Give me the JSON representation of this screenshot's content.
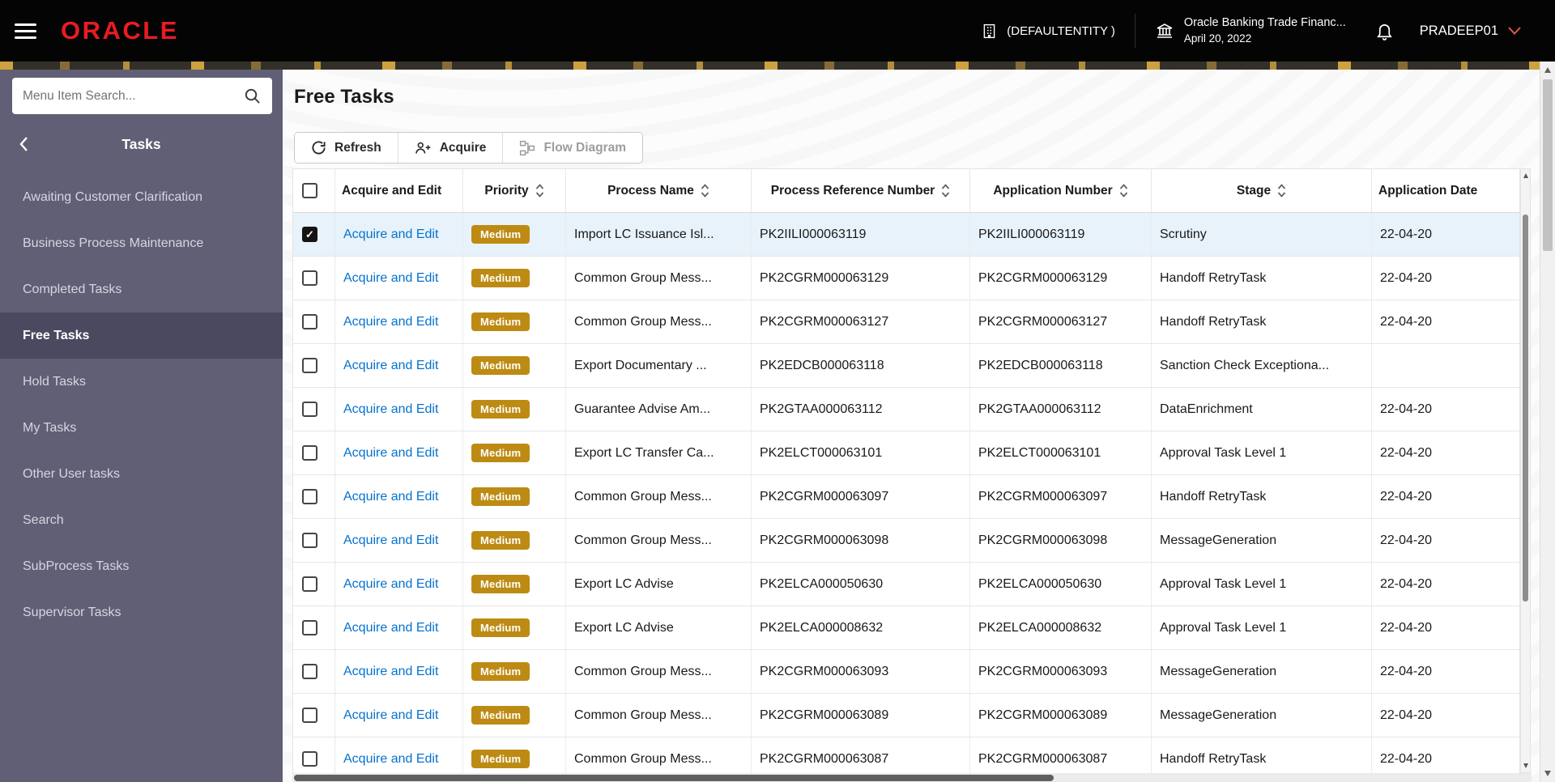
{
  "header": {
    "brand": "ORACLE",
    "entity_label": "(DEFAULTENTITY )",
    "org_name": "Oracle Banking Trade Financ...",
    "org_date": "April 20, 2022",
    "username": "PRADEEP01"
  },
  "sidebar": {
    "search_placeholder": "Menu Item Search...",
    "title": "Tasks",
    "items": [
      {
        "label": "Awaiting Customer Clarification",
        "active": false
      },
      {
        "label": "Business Process Maintenance",
        "active": false
      },
      {
        "label": "Completed Tasks",
        "active": false
      },
      {
        "label": "Free Tasks",
        "active": true
      },
      {
        "label": "Hold Tasks",
        "active": false
      },
      {
        "label": "My Tasks",
        "active": false
      },
      {
        "label": "Other User tasks",
        "active": false
      },
      {
        "label": "Search",
        "active": false
      },
      {
        "label": "SubProcess Tasks",
        "active": false
      },
      {
        "label": "Supervisor Tasks",
        "active": false
      }
    ]
  },
  "main": {
    "title": "Free Tasks",
    "toolbar": {
      "refresh_label": "Refresh",
      "acquire_label": "Acquire",
      "flow_diagram_label": "Flow Diagram",
      "flow_diagram_disabled": true
    },
    "table": {
      "columns": [
        {
          "label": "Acquire and Edit",
          "sortable": false
        },
        {
          "label": "Priority",
          "sortable": true
        },
        {
          "label": "Process Name",
          "sortable": true
        },
        {
          "label": "Process Reference Number",
          "sortable": true
        },
        {
          "label": "Application Number",
          "sortable": true
        },
        {
          "label": "Stage",
          "sortable": true
        },
        {
          "label": "Application Date",
          "sortable": false
        }
      ],
      "rows": [
        {
          "selected": true,
          "checked": true,
          "action": "Acquire and Edit",
          "priority": "Medium",
          "process_name": "Import LC Issuance Isl...",
          "process_ref": "PK2IILI000063119",
          "app_no": "PK2IILI000063119",
          "stage": "Scrutiny",
          "app_date": "22-04-20"
        },
        {
          "selected": false,
          "checked": false,
          "action": "Acquire and Edit",
          "priority": "Medium",
          "process_name": "Common Group Mess...",
          "process_ref": "PK2CGRM000063129",
          "app_no": "PK2CGRM000063129",
          "stage": "Handoff RetryTask",
          "app_date": "22-04-20"
        },
        {
          "selected": false,
          "checked": false,
          "action": "Acquire and Edit",
          "priority": "Medium",
          "process_name": "Common Group Mess...",
          "process_ref": "PK2CGRM000063127",
          "app_no": "PK2CGRM000063127",
          "stage": "Handoff RetryTask",
          "app_date": "22-04-20"
        },
        {
          "selected": false,
          "checked": false,
          "action": "Acquire and Edit",
          "priority": "Medium",
          "process_name": "Export Documentary ...",
          "process_ref": "PK2EDCB000063118",
          "app_no": "PK2EDCB000063118",
          "stage": "Sanction Check Exceptiona...",
          "app_date": ""
        },
        {
          "selected": false,
          "checked": false,
          "action": "Acquire and Edit",
          "priority": "Medium",
          "process_name": "Guarantee Advise Am...",
          "process_ref": "PK2GTAA000063112",
          "app_no": "PK2GTAA000063112",
          "stage": "DataEnrichment",
          "app_date": "22-04-20"
        },
        {
          "selected": false,
          "checked": false,
          "action": "Acquire and Edit",
          "priority": "Medium",
          "process_name": "Export LC Transfer Ca...",
          "process_ref": "PK2ELCT000063101",
          "app_no": "PK2ELCT000063101",
          "stage": "Approval Task Level 1",
          "app_date": "22-04-20"
        },
        {
          "selected": false,
          "checked": false,
          "action": "Acquire and Edit",
          "priority": "Medium",
          "process_name": "Common Group Mess...",
          "process_ref": "PK2CGRM000063097",
          "app_no": "PK2CGRM000063097",
          "stage": "Handoff RetryTask",
          "app_date": "22-04-20"
        },
        {
          "selected": false,
          "checked": false,
          "action": "Acquire and Edit",
          "priority": "Medium",
          "process_name": "Common Group Mess...",
          "process_ref": "PK2CGRM000063098",
          "app_no": "PK2CGRM000063098",
          "stage": "MessageGeneration",
          "app_date": "22-04-20"
        },
        {
          "selected": false,
          "checked": false,
          "action": "Acquire and Edit",
          "priority": "Medium",
          "process_name": "Export LC Advise",
          "process_ref": "PK2ELCA000050630",
          "app_no": "PK2ELCA000050630",
          "stage": "Approval Task Level 1",
          "app_date": "22-04-20"
        },
        {
          "selected": false,
          "checked": false,
          "action": "Acquire and Edit",
          "priority": "Medium",
          "process_name": "Export LC Advise",
          "process_ref": "PK2ELCA000008632",
          "app_no": "PK2ELCA000008632",
          "stage": "Approval Task Level 1",
          "app_date": "22-04-20"
        },
        {
          "selected": false,
          "checked": false,
          "action": "Acquire and Edit",
          "priority": "Medium",
          "process_name": "Common Group Mess...",
          "process_ref": "PK2CGRM000063093",
          "app_no": "PK2CGRM000063093",
          "stage": "MessageGeneration",
          "app_date": "22-04-20"
        },
        {
          "selected": false,
          "checked": false,
          "action": "Acquire and Edit",
          "priority": "Medium",
          "process_name": "Common Group Mess...",
          "process_ref": "PK2CGRM000063089",
          "app_no": "PK2CGRM000063089",
          "stage": "MessageGeneration",
          "app_date": "22-04-20"
        },
        {
          "selected": false,
          "checked": false,
          "action": "Acquire and Edit",
          "priority": "Medium",
          "process_name": "Common Group Mess...",
          "process_ref": "PK2CGRM000063087",
          "app_no": "PK2CGRM000063087",
          "stage": "Handoff RetryTask",
          "app_date": "22-04-20"
        }
      ]
    }
  },
  "icons": {
    "hamburger_menu": "≡",
    "search": "⌕",
    "back_chevron": "‹",
    "building": "🏢",
    "bank_branch": "🏛",
    "notification_bell": "🔔",
    "user_chevron_down": "⌄",
    "refresh": "⟳",
    "acquire_user_plus": "👤+",
    "flow_diagram": "⊞",
    "sort": "⇅",
    "checkbox_checked": "☑",
    "checkbox_unchecked": "☐",
    "scroll_up": "▲",
    "scroll_down": "▼"
  },
  "colors": {
    "header_bg": "#040404",
    "brand_red": "#ea1b22",
    "sidebar_bg": "#615f75",
    "sidebar_active_bg": "#4b4960",
    "link_blue": "#0572ce",
    "priority_medium_bg": "#bd8b13",
    "selected_row_bg": "#e8f2fa"
  }
}
